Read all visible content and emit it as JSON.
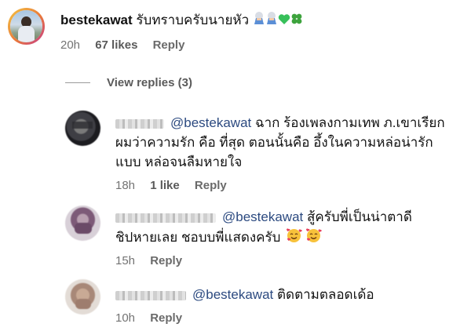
{
  "top_comment": {
    "username": "bestekawat",
    "text": "รับทราบครับนายหัว",
    "emojis": [
      "person-bowing-emoji",
      "person-bowing-emoji",
      "green-heart-emoji",
      "four-leaf-clover-emoji"
    ],
    "time": "20h",
    "likes": "67 likes",
    "reply_label": "Reply"
  },
  "view_replies": "View replies (3)",
  "replies": [
    {
      "mention": "@bestekawat",
      "lines": [
        "ฉาก ร้องเพลงกามเทพ ภ.เขาเรียก",
        "ผมว่าความรัก คือ ที่สุด ตอนนั้นคือ อึ้งในความหล่อน่ารัก",
        "แบบ หล่อจนลืมหายใจ"
      ],
      "time": "18h",
      "likes": "1 like",
      "reply_label": "Reply"
    },
    {
      "mention": "@bestekawat",
      "lines": [
        "สู้ครับพี่เป็นน่าตาดี",
        "ชิปหายเลย ชอบบพี่แสดงครับ"
      ],
      "emojis": [
        "smiling-face-with-hearts-emoji",
        "smiling-face-with-hearts-emoji"
      ],
      "time": "15h",
      "reply_label": "Reply"
    },
    {
      "mention": "@bestekawat",
      "lines": [
        "ติดตามตลอดเด้อ"
      ],
      "time": "10h",
      "reply_label": "Reply"
    }
  ],
  "colors": {
    "mention": "#2c4a80",
    "meta": "#737373",
    "heart": "#37c05a",
    "clover": "#3da33d"
  }
}
